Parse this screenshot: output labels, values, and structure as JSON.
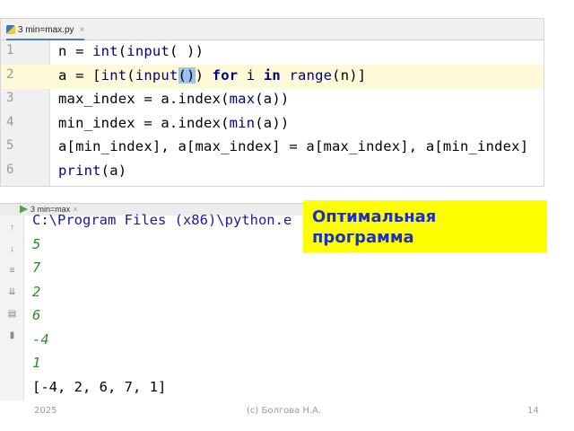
{
  "editor": {
    "tab_label": "3 min=max.py",
    "tab_close": "×",
    "lines": [
      {
        "num": "1",
        "segments": [
          {
            "t": "n = "
          },
          {
            "t": "int",
            "c": "bi"
          },
          {
            "t": "("
          },
          {
            "t": "input",
            "c": "bi"
          },
          {
            "t": "( ))"
          }
        ]
      },
      {
        "num": "2",
        "segments": [
          {
            "t": "a = ["
          },
          {
            "t": "int",
            "c": "bi"
          },
          {
            "t": "("
          },
          {
            "t": "input",
            "c": "bi"
          },
          {
            "t": "()",
            "c": "paren-hl"
          },
          {
            "t": ") "
          },
          {
            "t": "for",
            "c": "kw"
          },
          {
            "t": " i "
          },
          {
            "t": "in",
            "c": "kw"
          },
          {
            "t": " "
          },
          {
            "t": "range",
            "c": "bi"
          },
          {
            "t": "(n)]"
          }
        ]
      },
      {
        "num": "3",
        "segments": [
          {
            "t": "max_index = a.index("
          },
          {
            "t": "max",
            "c": "bi"
          },
          {
            "t": "(a))"
          }
        ]
      },
      {
        "num": "4",
        "segments": [
          {
            "t": "min_index = a.index("
          },
          {
            "t": "min",
            "c": "bi"
          },
          {
            "t": "(a))"
          }
        ]
      },
      {
        "num": "5",
        "segments": [
          {
            "t": "a[min_index], a[max_index] = a[max_index], a[min_index]"
          }
        ]
      },
      {
        "num": "6",
        "segments": [
          {
            "t": "print",
            "c": "bi"
          },
          {
            "t": "(a)"
          }
        ]
      }
    ]
  },
  "run": {
    "tab_label": "3 min=max",
    "tab_close": "×",
    "path_line": "C:\\Program Files (x86)\\python.e",
    "inputs": [
      "5",
      "7",
      "2",
      "6",
      "-4",
      "1"
    ],
    "output": "[-4, 2, 6, 7, 1]"
  },
  "callout": {
    "line1": "Оптимальная",
    "line2": "программа"
  },
  "footer": {
    "year": "2025",
    "author": "(c) Болгова Н.А.",
    "page": "14"
  },
  "colors": {
    "callout_bg": "#ffff00",
    "callout_text": "#1a2ec8",
    "keyword": "#000080",
    "console_input": "#2f8a2f",
    "current_line": "#fcfad8"
  }
}
